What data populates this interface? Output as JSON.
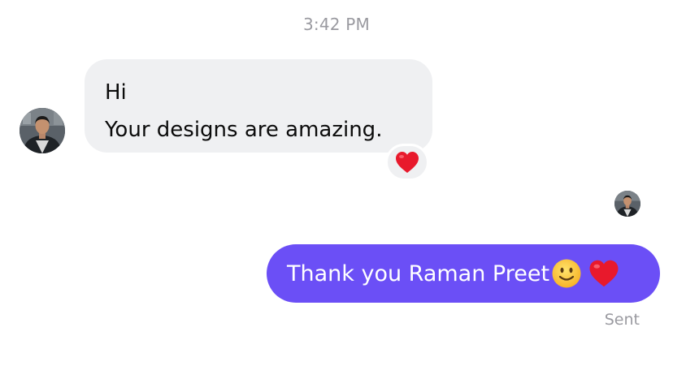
{
  "timestamp": "3:42 PM",
  "contact": {
    "avatar_icon": "profile-photo"
  },
  "incoming_message": {
    "lines": [
      "Hi",
      "Your designs are amazing."
    ],
    "reaction_icon": "red-heart-icon"
  },
  "outgoing_message": {
    "text": "Thank you Raman Preet",
    "emojis": [
      "slightly-smiling-face-icon",
      "red-heart-icon"
    ],
    "status": "Sent"
  },
  "colors": {
    "incoming_bubble": "#eff0f2",
    "outgoing_bubble": "#6b4ff6",
    "heart": "#e8192c",
    "meta_text": "#9a9aa0"
  }
}
